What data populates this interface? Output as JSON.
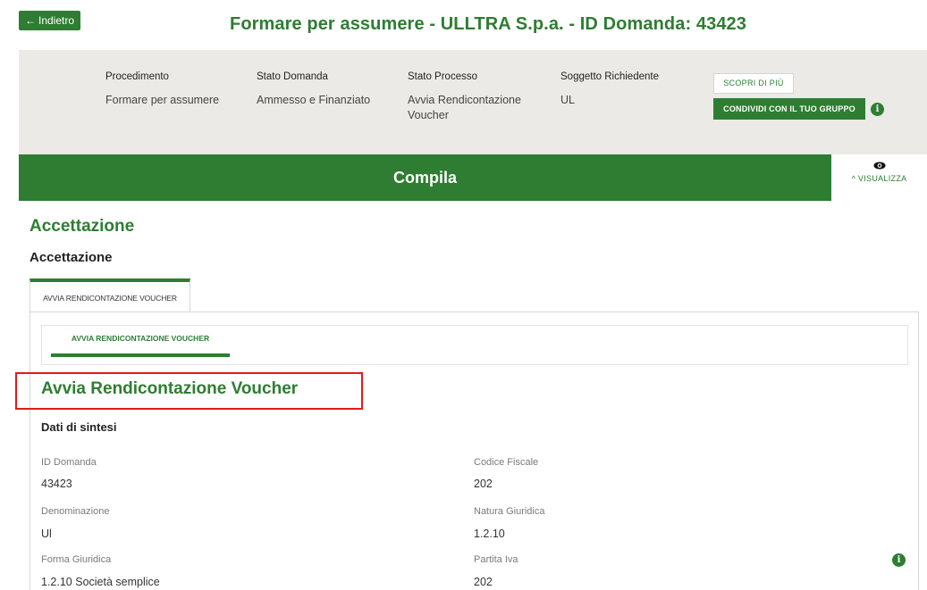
{
  "header": {
    "back_label": "Indietro",
    "back_icon": "arrow-left-icon",
    "title": "Formare per assumere - ULLTRA S.p.a. - ID Domanda: 43423"
  },
  "summary": {
    "columns": [
      {
        "label": "Procedimento",
        "value": "Formare per assumere"
      },
      {
        "label": "Stato Domanda",
        "value": "Ammesso e Finanziato"
      },
      {
        "label": "Stato Processo",
        "value": "Avvia Rendicontazione Voucher"
      },
      {
        "label": "Soggetto Richiedente",
        "value": "UL"
      }
    ],
    "scopri_label": "SCOPRI DI PIÙ",
    "condividi_label": "CONDIVIDI CON IL TUO GRUPPO"
  },
  "compila": {
    "label": "Compila",
    "visualizza_label": "VISUALIZZA"
  },
  "section": {
    "title": "Accettazione",
    "subtitle": "Accettazione",
    "tab_label": "AVVIA RENDICONTAZIONE VOUCHER",
    "subtab_label": "AVVIA RENDICONTAZIONE VOUCHER"
  },
  "content": {
    "title": "Avvia Rendicontazione Voucher",
    "dati_title": "Dati di sintesi",
    "fields": [
      {
        "label": "ID Domanda",
        "value": "43423"
      },
      {
        "label": "Codice Fiscale",
        "value": "202"
      },
      {
        "label": "Denominazione",
        "value": "Ul"
      },
      {
        "label": "Natura Giuridica",
        "value": "1.2.10"
      },
      {
        "label": "Forma Giuridica",
        "value": "1.2.10 Società semplice"
      },
      {
        "label": "Partita Iva",
        "value": "202"
      }
    ]
  },
  "colors": {
    "accent": "#2e7d32",
    "summary_bg": "#ebeae6",
    "highlight": "#e11a1a"
  }
}
